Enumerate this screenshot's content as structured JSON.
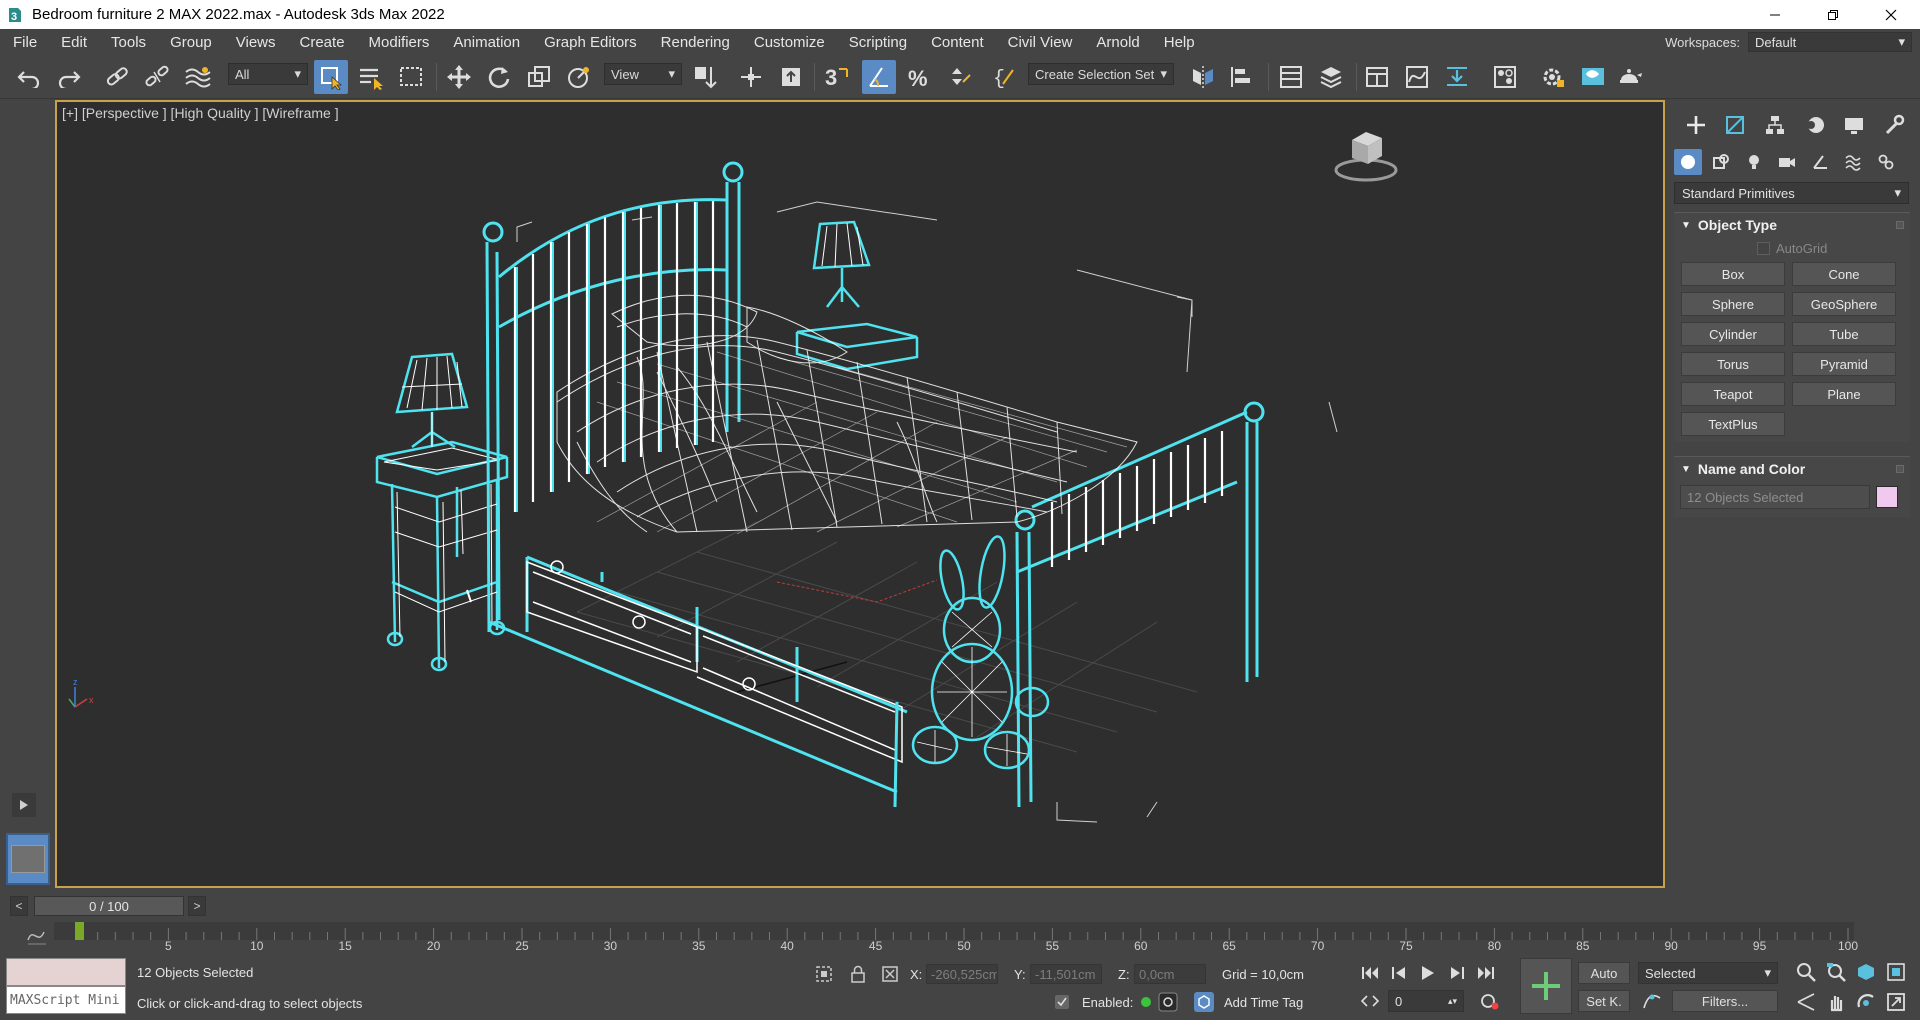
{
  "window": {
    "title": "Bedroom furniture 2 MAX 2022.max - Autodesk 3ds Max 2022",
    "controls": [
      "minimize-icon",
      "restore-icon",
      "close-icon"
    ]
  },
  "menu": {
    "items": [
      "File",
      "Edit",
      "Tools",
      "Group",
      "Views",
      "Create",
      "Modifiers",
      "Animation",
      "Graph Editors",
      "Rendering",
      "Customize",
      "Scripting",
      "Content",
      "Civil View",
      "Arnold",
      "Help"
    ],
    "workspaces_label": "Workspaces:",
    "workspace_value": "Default"
  },
  "toolbar": {
    "selection_filter": "All",
    "ref_coord": "View",
    "selection_set": "Create Selection Set",
    "active_tool": "select-object",
    "accent": "#5b8bc4"
  },
  "viewport": {
    "label": "[+] [Perspective ] [High Quality ] [Wireframe ]",
    "border_color": "#c7a24b",
    "selection_color": "#4fe3ef",
    "wire_color": "#ffffff"
  },
  "command_panel": {
    "category": "Standard Primitives",
    "object_type": {
      "title": "Object Type",
      "autogrid": "AutoGrid",
      "buttons": [
        "Box",
        "Cone",
        "Sphere",
        "GeoSphere",
        "Cylinder",
        "Tube",
        "Torus",
        "Pyramid",
        "Teapot",
        "Plane",
        "TextPlus"
      ]
    },
    "name_color": {
      "title": "Name and Color",
      "name_value": "12 Objects Selected",
      "swatch_color": "#f0c8f0"
    }
  },
  "timeline": {
    "frame_display": "0 / 100",
    "prev": "<",
    "next": ">",
    "ticks": [
      "5",
      "10",
      "15",
      "20",
      "25",
      "30",
      "35",
      "40",
      "45",
      "50",
      "55",
      "60",
      "65",
      "70",
      "75",
      "80",
      "85",
      "90",
      "95",
      "100"
    ]
  },
  "status": {
    "maxscript_placeholder": "MAXScript Mini",
    "selection_text": "12 Objects Selected",
    "prompt_text": "Click or click-and-drag to select objects",
    "x_label": "X:",
    "x_value": "-260,525cm",
    "y_label": "Y:",
    "y_value": "-11,501cm",
    "z_label": "Z:",
    "z_value": "0,0cm",
    "grid_text": "Grid = 10,0cm",
    "enabled_label": "Enabled:",
    "add_time_tag": "Add Time Tag",
    "auto_label": "Auto",
    "setkey_label": "Set K.",
    "key_mode": "Selected",
    "filters_label": "Filters...",
    "frame_value": "0"
  }
}
